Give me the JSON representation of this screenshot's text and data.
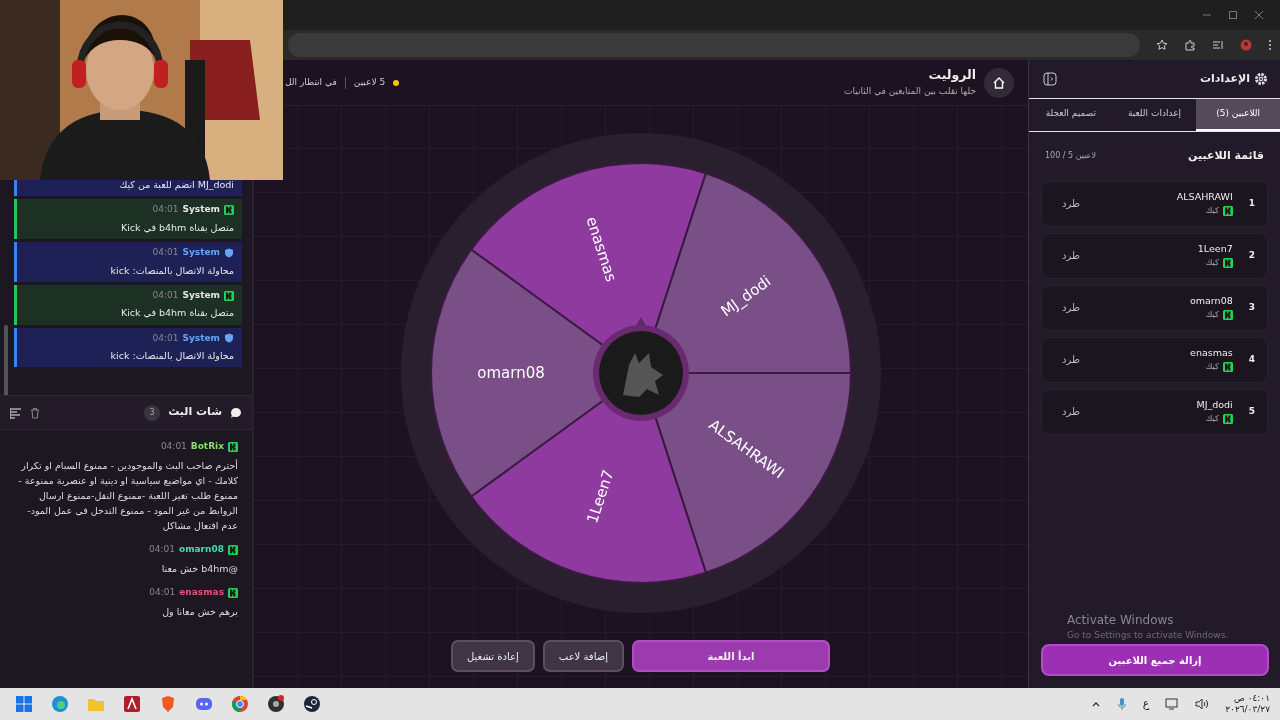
{
  "log": {
    "entries": [
      {
        "kind": "info",
        "text": "MJ_dodi انضم للعبة من كيك"
      },
      {
        "kind": "success",
        "author": "System",
        "time": "04:01",
        "text": "متصل بقناة b4hm في Kick"
      },
      {
        "kind": "info",
        "author": "System",
        "time": "04:01",
        "text": "محاولة الاتصال بالمنصات: kick"
      },
      {
        "kind": "success",
        "author": "System",
        "time": "04:01",
        "text": "متصل بقناة b4hm في Kick"
      },
      {
        "kind": "info",
        "author": "System",
        "time": "04:01",
        "text": "محاولة الاتصال بالمنصات: kick"
      }
    ]
  },
  "chat": {
    "title": "شات البث",
    "count": "3",
    "messages": [
      {
        "user": "BotRix",
        "color": "#86e06a",
        "time": "04:01",
        "text": "أحترم صاحب البث والموجودين - ممنوع السبام او تكرار كلامك - اي مواضيع سياسية او دينية او عنصرية ممنوعة - ممنوع طلب تغير اللعبة -ممنوع النقل-ممنوع ارسال الروابط من غير المود - ممنوع التدخل في عمل المود-عدم افتعال مشاكل"
      },
      {
        "user": "omarn08",
        "color": "#3ee0b0",
        "time": "04:01",
        "text": "@b4hm خش معنا"
      },
      {
        "user": "enasmas",
        "color": "#e0507a",
        "time": "04:01",
        "text": "برهم خش معانا ول"
      }
    ]
  },
  "header": {
    "title": "الروليت",
    "subtitle": "خلها تقلب بين المتابعين في الثانيات",
    "player_count": "5 لاعبين",
    "status": "في انتظار الل"
  },
  "wheel": {
    "segments": [
      {
        "label": "enasmas",
        "color": "#8e3a9f"
      },
      {
        "label": "MJ_dodi",
        "color": "#7a4e86"
      },
      {
        "label": "ALSAHRAWI",
        "color": "#7a4e86"
      },
      {
        "label": "1Leen7",
        "color": "#8e3a9f"
      },
      {
        "label": "omarn08",
        "color": "#7a4e86"
      }
    ]
  },
  "actions": [
    {
      "label": "ابدأ اللعبة",
      "kind": "primary"
    },
    {
      "label": "إضافة لاعب",
      "kind": "secondary"
    },
    {
      "label": "إعادة تشغيل",
      "kind": "secondary"
    }
  ],
  "settings": {
    "title": "الإعدادات",
    "tabs": [
      {
        "label": "اللاعبين (5)",
        "selected": true
      },
      {
        "label": "إعدادات اللعبة",
        "selected": false
      },
      {
        "label": "تصميم العجلة",
        "selected": false
      }
    ],
    "list_title": "قائمة اللاعبين",
    "list_count": "100 / 5 لاعبين",
    "players": [
      {
        "number": "1",
        "name": "ALSAHRAWI",
        "platform": "كيك",
        "action": "طرد"
      },
      {
        "number": "2",
        "name": "1Leen7",
        "platform": "كيك",
        "action": "طرد"
      },
      {
        "number": "3",
        "name": "omarn08",
        "platform": "كيك",
        "action": "طرد"
      },
      {
        "number": "4",
        "name": "enasmas",
        "platform": "كيك",
        "action": "طرد"
      },
      {
        "number": "5",
        "name": "MJ_dodi",
        "platform": "كيك",
        "action": "طرد"
      }
    ],
    "clear_button": "إزالة جميع اللاعبين"
  },
  "os_notice": {
    "title": "Activate Windows",
    "subtitle": "Go to Settings to activate Windows."
  },
  "taskbar": {
    "language": "ع",
    "time": "٠٤:٠١ ص",
    "date": "٢٠٢٦/٠٣/٢٧"
  }
}
